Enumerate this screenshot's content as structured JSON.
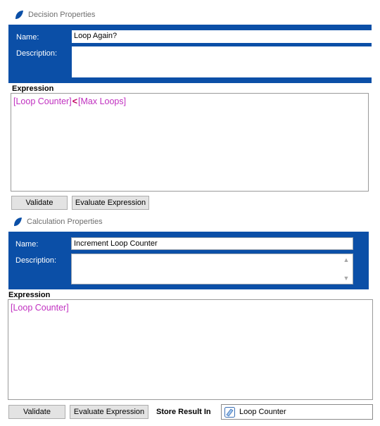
{
  "decision": {
    "panel_title": "Decision Properties",
    "name_label": "Name:",
    "name_value": "Loop Again?",
    "description_label": "Description:",
    "description_value": "",
    "expression_label": "Expression",
    "expression_left": "[Loop Counter]",
    "expression_operator": "<",
    "expression_right": "[Max Loops]",
    "validate_label": "Validate",
    "evaluate_label": "Evaluate Expression"
  },
  "calculation": {
    "panel_title": "Calculation Properties",
    "name_label": "Name:",
    "name_value": "Increment Loop Counter",
    "description_label": "Description:",
    "description_value": "",
    "expression_label": "Expression",
    "expression_text": "[Loop Counter]",
    "validate_label": "Validate",
    "evaluate_label": "Evaluate Expression",
    "store_result_label": "Store Result In",
    "store_result_value": "Loop Counter"
  },
  "colors": {
    "panel_blue": "#0b4fa7",
    "token_magenta": "#c030c0",
    "operator_red": "#c00060"
  },
  "icons": {
    "panel_logo": "blue-leaf-icon",
    "store_field": "data-item-icon"
  }
}
